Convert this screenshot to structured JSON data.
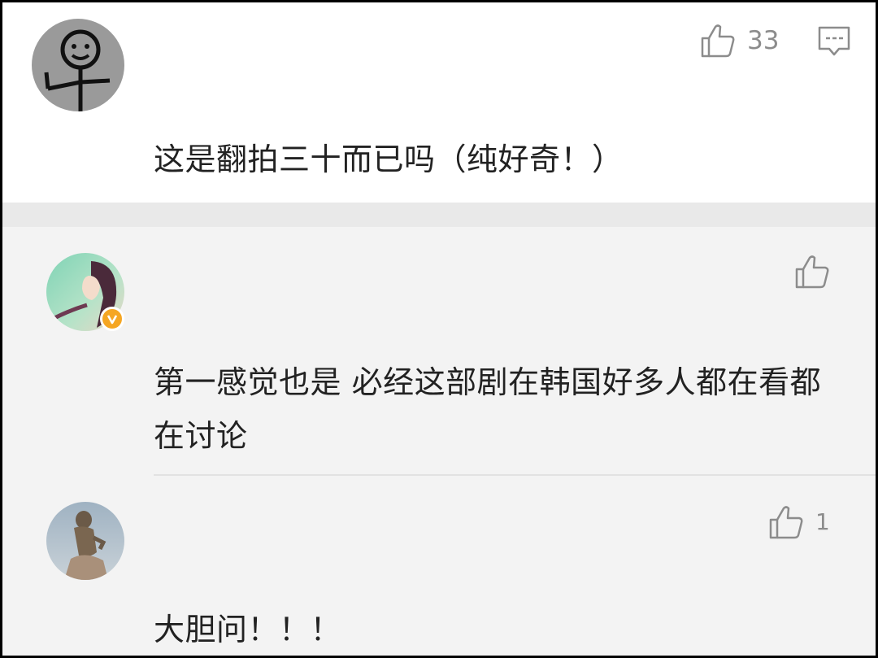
{
  "comments": [
    {
      "avatar_icon": "stick-figure-avatar-icon",
      "likes": "33",
      "text": "这是翻拍三十而已吗（纯好奇！）"
    },
    {
      "avatar_icon": "anime-girl-avatar-icon",
      "verified": true,
      "likes": "",
      "text": "第一感觉也是 必经这部剧在韩国好多人都在看都在讨论"
    },
    {
      "avatar_icon": "statue-avatar-icon",
      "likes": "1",
      "text": "大胆问！！！"
    }
  ],
  "colors": {
    "badge": "#f5a623",
    "icon_gray": "#8c8c8c",
    "text": "#222222"
  }
}
